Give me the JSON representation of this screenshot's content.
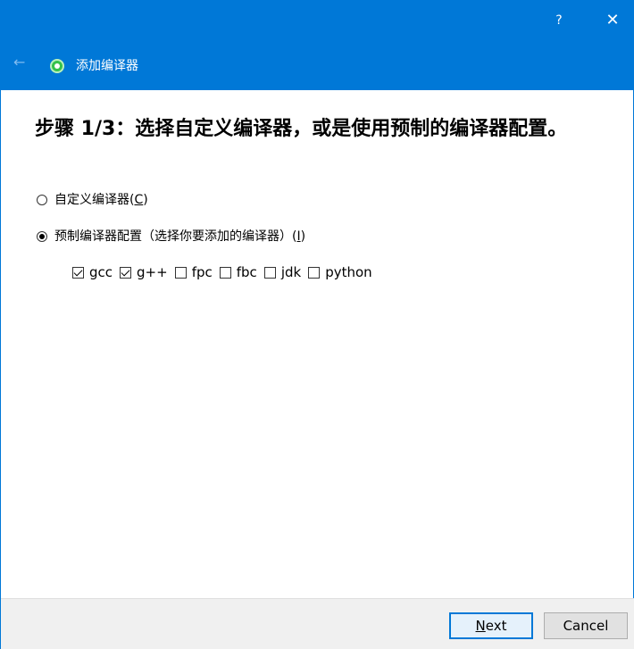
{
  "window": {
    "help_label": "?",
    "close_label": "✕",
    "back_label": "←",
    "title": "添加编译器"
  },
  "heading": "步骤 1/3：选择自定义编译器，或是使用预制的编译器配置。",
  "options": {
    "custom": {
      "label": "自定义编译器",
      "accel_open": "(",
      "accel_key": "C",
      "accel_close": ")",
      "checked": false
    },
    "preset": {
      "label": "预制编译器配置（选择你要添加的编译器）",
      "accel_open": "(",
      "accel_key": "I",
      "accel_close": ")",
      "checked": true
    }
  },
  "compilers": [
    {
      "label": "gcc",
      "checked": true
    },
    {
      "label": "g++",
      "checked": true
    },
    {
      "label": "fpc",
      "checked": false
    },
    {
      "label": "fbc",
      "checked": false
    },
    {
      "label": "jdk",
      "checked": false
    },
    {
      "label": "python",
      "checked": false
    }
  ],
  "buttons": {
    "next_accel": "N",
    "next_rest": "ext",
    "cancel": "Cancel"
  },
  "colors": {
    "accent": "#0078d7",
    "icon_green": "#35c24a"
  }
}
